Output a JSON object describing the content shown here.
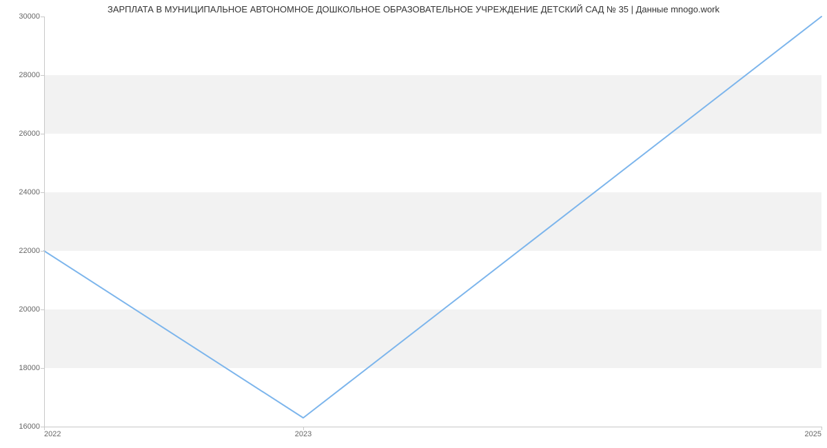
{
  "chart_data": {
    "type": "line",
    "title": "ЗАРПЛАТА В МУНИЦИПАЛЬНОЕ АВТОНОМНОЕ ДОШКОЛЬНОЕ ОБРАЗОВАТЕЛЬНОЕ УЧРЕЖДЕНИЕ ДЕТСКИЙ САД № 35 | Данные mnogo.work",
    "x": [
      2022,
      2023,
      2025
    ],
    "values": [
      22000,
      16300,
      30000
    ],
    "xlabel": "",
    "ylabel": "",
    "xlim": [
      2022,
      2025
    ],
    "ylim": [
      16000,
      30000
    ],
    "y_ticks": [
      16000,
      18000,
      20000,
      22000,
      24000,
      26000,
      28000,
      30000
    ],
    "x_ticks": [
      2022,
      2023,
      2025
    ],
    "line_color": "#7cb5ec",
    "band_color": "#f2f2f2"
  }
}
